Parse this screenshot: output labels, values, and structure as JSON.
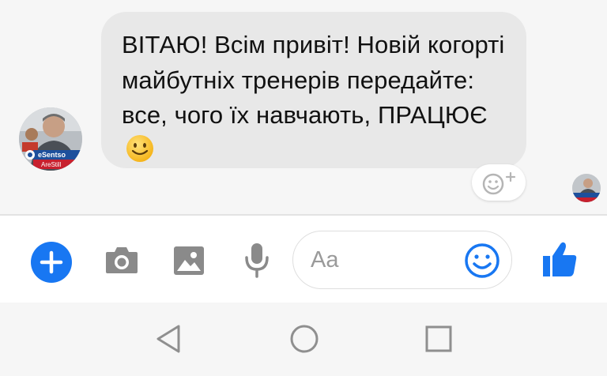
{
  "conversation": {
    "message": {
      "text": "ВІТАЮ! Всім привіт! Новій когорті майбутніх тренерів передайте: все,  чого їх навчають, ПРАЦЮЄ",
      "emoji": "slightly-smiling-face-icon"
    },
    "sender_avatar": {
      "badge_lines": [
        "eSentso",
        "AreStill"
      ]
    },
    "read_receipt_avatar": "avatar"
  },
  "composer": {
    "placeholder": "Aa",
    "icons": [
      "plus-icon",
      "camera-icon",
      "image-icon",
      "microphone-icon",
      "emoji-icon",
      "thumbs-up-icon"
    ]
  },
  "navigation": {
    "icons": [
      "back-icon",
      "home-icon",
      "recents-icon"
    ]
  },
  "colors": {
    "accent": "#1877f2",
    "bubble": "#e8e8e8",
    "icon_gray": "#8a8a8a",
    "background": "#f6f6f6"
  }
}
